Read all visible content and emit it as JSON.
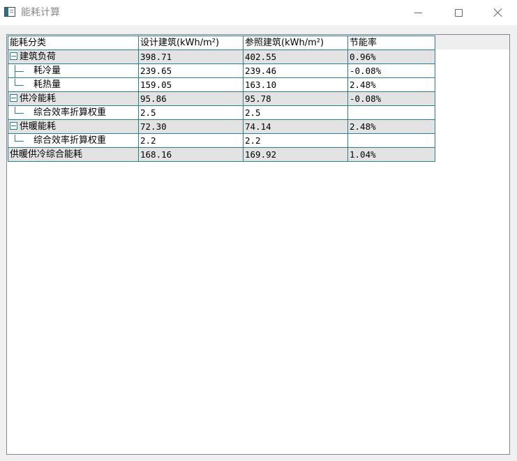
{
  "window": {
    "title": "能耗计算",
    "icon": "app-window-icon",
    "controls": [
      "minimize-icon",
      "maximize-icon",
      "close-icon"
    ]
  },
  "table": {
    "headers": {
      "category": "能耗分类",
      "design": "设计建筑(kWh/m²)",
      "reference": "参照建筑(kWh/m²)",
      "saving": "节能率"
    },
    "rows": [
      {
        "kind": "group",
        "label": "建筑负荷",
        "design": "398.71",
        "reference": "402.55",
        "saving": "0.96%"
      },
      {
        "kind": "child",
        "label": "耗冷量",
        "design": "239.65",
        "reference": "239.46",
        "saving": "-0.08%"
      },
      {
        "kind": "child-last",
        "label": "耗热量",
        "design": "159.05",
        "reference": "163.10",
        "saving": "2.48%"
      },
      {
        "kind": "group",
        "label": "供冷能耗",
        "design": "95.86",
        "reference": "95.78",
        "saving": "-0.08%"
      },
      {
        "kind": "child-last",
        "label": "综合效率折算权重",
        "design": "2.5",
        "reference": "2.5",
        "saving": ""
      },
      {
        "kind": "group",
        "label": "供暖能耗",
        "design": "72.30",
        "reference": "74.14",
        "saving": "2.48%"
      },
      {
        "kind": "child-last",
        "label": "综合效率折算权重",
        "design": "2.2",
        "reference": "2.2",
        "saving": ""
      },
      {
        "kind": "total",
        "label": "供暖供冷综合能耗",
        "design": "168.16",
        "reference": "169.92",
        "saving": "1.04%"
      }
    ]
  }
}
